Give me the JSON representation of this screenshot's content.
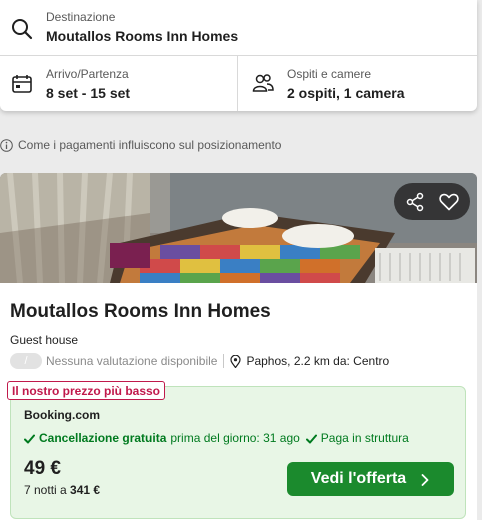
{
  "search": {
    "destination_label": "Destinazione",
    "destination_value": "Moutallos Rooms Inn Homes",
    "dates_label": "Arrivo/Partenza",
    "dates_value": "8 set - 15 set",
    "guests_label": "Ospiti e camere",
    "guests_value": "2 ospiti, 1 camera"
  },
  "info_text": "Come i pagamenti influiscono sul posizionamento",
  "hotel": {
    "name": "Moutallos Rooms Inn Homes",
    "type": "Guest house",
    "rating_placeholder": "/",
    "rating_text": "Nessuna valutazione disponibile",
    "location": "Paphos, 2.2 km da: Centro"
  },
  "offer": {
    "badge": "Il nostro prezzo più basso",
    "provider": "Booking.com",
    "free_cancel": "Cancellazione gratuita",
    "cancel_until": "prima del giorno: 31 ago",
    "pay_at_property": "Paga in struttura",
    "price": "49 €",
    "nights_prefix": "7 notti a",
    "total": "341 €",
    "cta_label": "Vedi l'offerta"
  },
  "colors": {
    "accent_green": "#1b8a2d",
    "badge_red": "#c0194b",
    "offer_bg": "#e8f6e6"
  },
  "icons": [
    "search-icon",
    "calendar-icon",
    "guests-icon",
    "info-icon",
    "share-icon",
    "heart-icon",
    "map-pin-icon",
    "check-icon",
    "chevron-right-icon"
  ]
}
